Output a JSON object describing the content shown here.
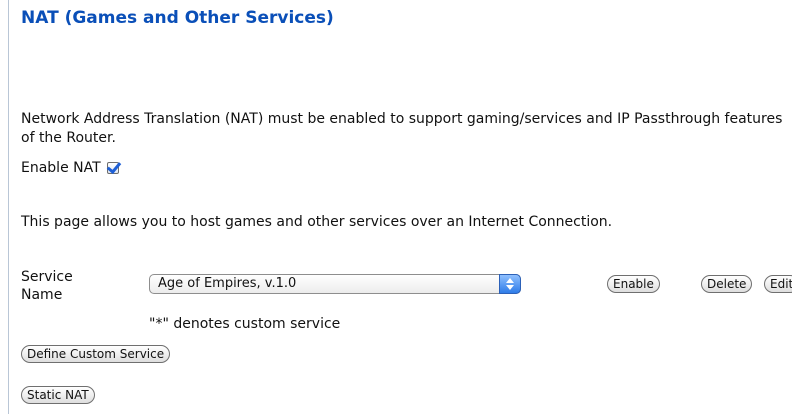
{
  "page": {
    "title": "NAT (Games and Other Services)",
    "nat_intro": "Network Address Translation (NAT) must be enabled to support gaming/services and IP Passthrough features of the Router.",
    "enable_nat_label": "Enable NAT",
    "enable_nat_checked": true,
    "hosting_text": "This page allows you to host games and other services over an Internet Connection.",
    "service_name_label": "Service Name",
    "service_selected": "Age of Empires, v.1.0",
    "custom_note": "\"*\" denotes custom service"
  },
  "buttons": {
    "enable": "Enable",
    "delete": "Delete",
    "edit": "Edit",
    "define_custom": "Define Custom Service",
    "static_nat": "Static NAT"
  },
  "colors": {
    "title": "#0a4fb8",
    "select_arrow": "#2f7ce8",
    "check": "#1e5fd6"
  }
}
